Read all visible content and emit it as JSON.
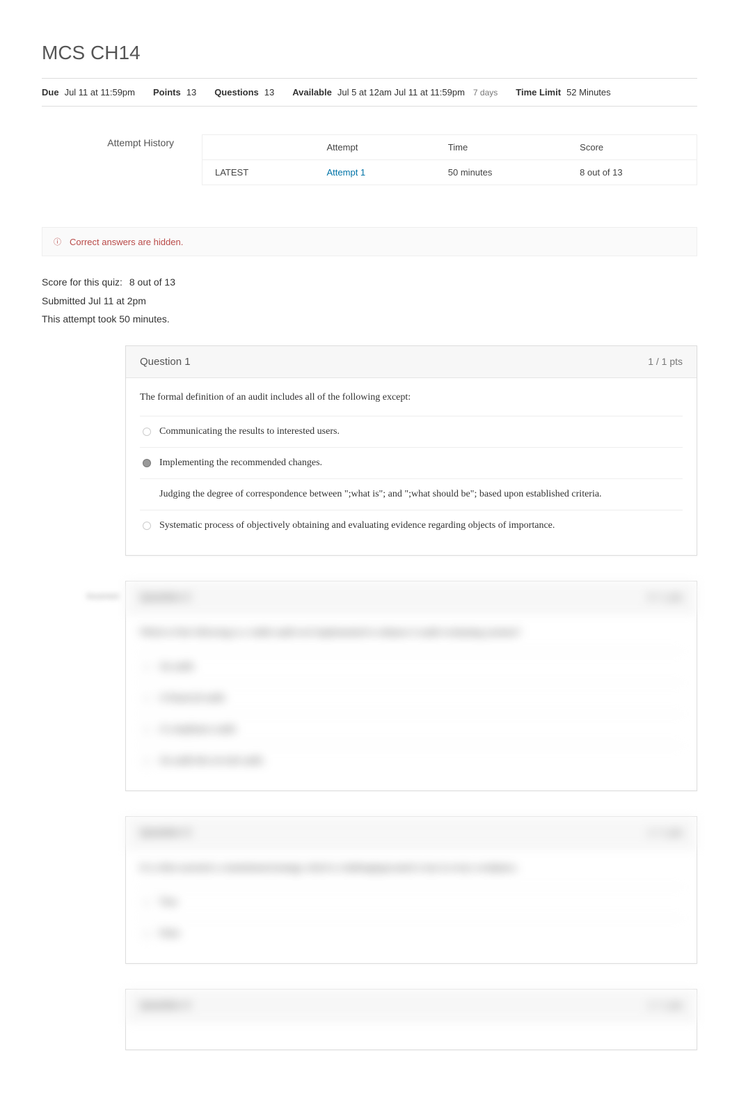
{
  "title": "MCS CH14",
  "meta": {
    "due_label": "Due",
    "due_value": "Jul 11 at 11:59pm",
    "points_label": "Points",
    "points_value": "13",
    "questions_label": "Questions",
    "questions_value": "13",
    "available_label": "Available",
    "available_value": "Jul 5 at 12am Jul 11 at 11:59pm",
    "available_duration": "7 days",
    "timelimit_label": "Time Limit",
    "timelimit_value": "52 Minutes"
  },
  "attempt_history": {
    "title": "Attempt History",
    "headers": {
      "attempt": "Attempt",
      "time": "Time",
      "score": "Score"
    },
    "rows": [
      {
        "latest": "LATEST",
        "attempt": "Attempt 1",
        "time": "50 minutes",
        "score": "8 out of 13"
      }
    ]
  },
  "notice": {
    "icon": "ⓘ",
    "text": "Correct answers are hidden."
  },
  "summary": {
    "score_label": "Score for this quiz:",
    "score_value": "8 out of 13",
    "submitted": "Submitted Jul 11 at 2pm",
    "duration": "This attempt took 50 minutes."
  },
  "questions": [
    {
      "label": "Question 1",
      "pts": "1 / 1 pts",
      "text": "The formal definition of an audit includes all of the following except:",
      "side_badge": "",
      "blurred": false,
      "answers": [
        {
          "text": "Communicating the results to interested users.",
          "selected": false
        },
        {
          "text": "Implementing the recommended changes.",
          "selected": true
        },
        {
          "text": "Judging the degree of correspondence between \";what is\"; and \";what should be\"; based upon established criteria.",
          "selected": false,
          "no_radio": true
        },
        {
          "text": "Systematic process of objectively obtaining and evaluating evidence regarding objects of importance.",
          "selected": false
        }
      ]
    },
    {
      "label": "Question 2",
      "pts": "0 / 1 pts",
      "text": "Which of the following is a viable audit tool implemented to enhance it audit evaluating systems?",
      "side_badge": "Incorrect",
      "blurred": true,
      "answers": [
        {
          "text": "An audit.",
          "selected": false
        },
        {
          "text": "A financial audit.",
          "selected": false
        },
        {
          "text": "A compliance audit.",
          "selected": false
        },
        {
          "text": "An audit-the-records audit.",
          "selected": false
        }
      ]
    },
    {
      "label": "Question 3",
      "pts": "1 / 1 pts",
      "text": "It is often asserted a commitment/strategy which is challenging/sound is true in every workplace.",
      "side_badge": "",
      "blurred": true,
      "answers": [
        {
          "text": "True",
          "selected": false
        },
        {
          "text": "False",
          "selected": false
        }
      ]
    },
    {
      "label": "Question 4",
      "pts": "1 / 1 pts",
      "text": "",
      "side_badge": "",
      "blurred": true,
      "answers": []
    }
  ]
}
